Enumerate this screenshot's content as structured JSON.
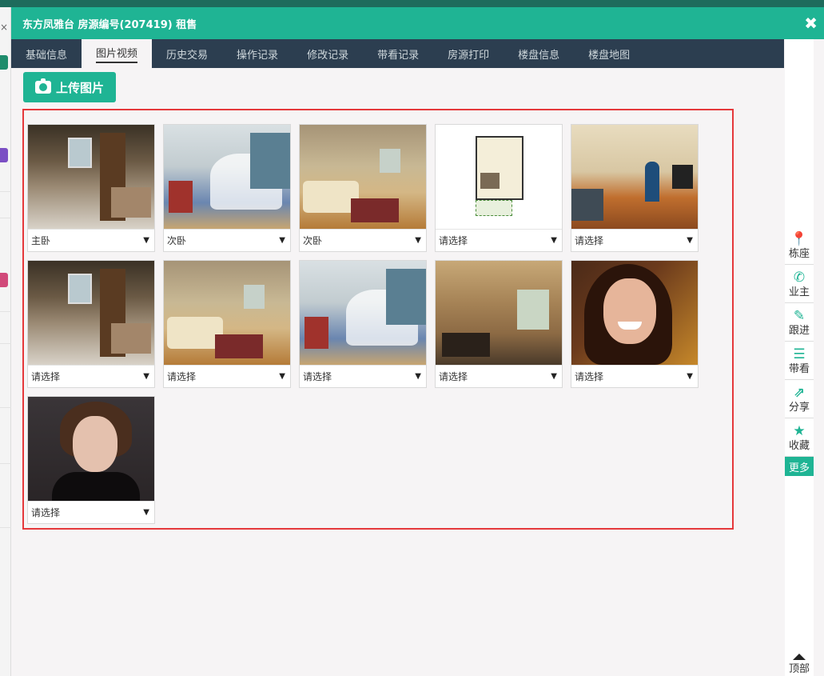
{
  "dialog": {
    "title": "东方凤雅台 房源编号(207419) 租售",
    "close_icon": "✖"
  },
  "tabs": [
    {
      "label": "基础信息",
      "active": false
    },
    {
      "label": "图片视频",
      "active": true
    },
    {
      "label": "历史交易",
      "active": false
    },
    {
      "label": "操作记录",
      "active": false
    },
    {
      "label": "修改记录",
      "active": false
    },
    {
      "label": "带看记录",
      "active": false
    },
    {
      "label": "房源打印",
      "active": false
    },
    {
      "label": "楼盘信息",
      "active": false
    },
    {
      "label": "楼盘地图",
      "active": false
    }
  ],
  "upload": {
    "label": "上传图片",
    "icon": "camera-icon"
  },
  "photos": [
    {
      "category": "主卧",
      "kind": "bedroom"
    },
    {
      "category": "次卧",
      "kind": "crib"
    },
    {
      "category": "次卧",
      "kind": "living"
    },
    {
      "category": "请选择",
      "kind": "plan"
    },
    {
      "category": "请选择",
      "kind": "hall"
    },
    {
      "category": "请选择",
      "kind": "bedroom"
    },
    {
      "category": "请选择",
      "kind": "living"
    },
    {
      "category": "请选择",
      "kind": "crib"
    },
    {
      "category": "请选择",
      "kind": "dining"
    },
    {
      "category": "请选择",
      "kind": "face1"
    },
    {
      "category": "请选择",
      "kind": "face2"
    }
  ],
  "sidebar": {
    "items": [
      {
        "label": "栋座",
        "icon": "location-pin-icon",
        "glyph": "📍"
      },
      {
        "label": "业主",
        "icon": "phone-icon",
        "glyph": "✆"
      },
      {
        "label": "跟进",
        "icon": "follow-doc-icon",
        "glyph": "✎"
      },
      {
        "label": "带看",
        "icon": "view-doc-icon",
        "glyph": "☰"
      },
      {
        "label": "分享",
        "icon": "share-icon",
        "glyph": "⇗"
      },
      {
        "label": "收藏",
        "icon": "star-icon",
        "glyph": "★"
      }
    ],
    "more_label": "更多",
    "top_label": "顶部"
  },
  "colors": {
    "accent": "#1fb494",
    "tab_bar": "#2c3e50",
    "highlight_border": "#e5383b"
  }
}
